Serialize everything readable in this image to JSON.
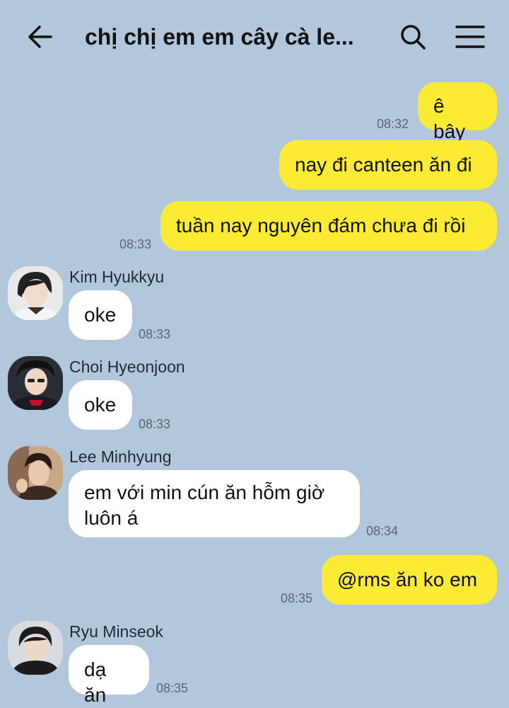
{
  "header": {
    "title": "chị chị em em cây cà le..."
  },
  "messages": [
    {
      "id": "m1",
      "side": "mine",
      "text": "ê bây",
      "time": "08:32"
    },
    {
      "id": "m2",
      "side": "mine",
      "text": "nay đi canteen ăn đi",
      "time": ""
    },
    {
      "id": "m3",
      "side": "mine",
      "text": "tuần nay nguyên đám chưa đi rồi",
      "time": "08:33"
    },
    {
      "id": "m4",
      "side": "theirs",
      "sender": "Kim Hyukkyu",
      "text": "oke",
      "time": "08:33"
    },
    {
      "id": "m5",
      "side": "theirs",
      "sender": "Choi Hyeonjoon",
      "text": "oke",
      "time": "08:33"
    },
    {
      "id": "m6",
      "side": "theirs",
      "sender": "Lee Minhyung",
      "text": "em với min cún ăn hỗm giờ luôn á",
      "time": "08:34"
    },
    {
      "id": "m7",
      "side": "mine",
      "text": "@rms ăn ko em",
      "time": "08:35"
    },
    {
      "id": "m8",
      "side": "theirs",
      "sender": "Ryu Minseok",
      "text": "dạ ăn",
      "time": "08:35"
    }
  ],
  "colors": {
    "background": "#b2c7dc",
    "my_bubble": "#fbeb34",
    "their_bubble": "#ffffff"
  }
}
